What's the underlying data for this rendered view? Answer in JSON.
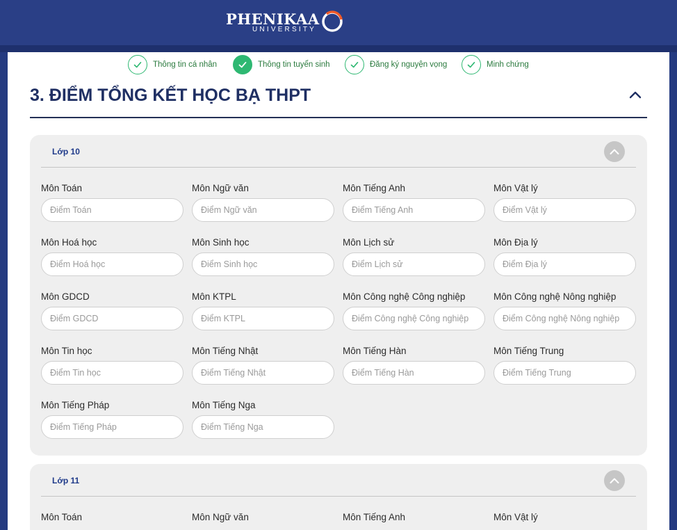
{
  "header": {
    "logo_main": "PHENIKAA",
    "logo_sub": "UNIVERSITY"
  },
  "steps": [
    {
      "label": "Thông tin cá nhân",
      "state": "done"
    },
    {
      "label": "Thông tin tuyển sinh",
      "state": "active"
    },
    {
      "label": "Đăng ký nguyện vọng",
      "state": "done"
    },
    {
      "label": "Minh chứng",
      "state": "done"
    }
  ],
  "section": {
    "title": "3. ĐIỂM TỔNG KẾT HỌC BẠ THPT",
    "collapse_icon": "chevron-up-icon"
  },
  "grade10": {
    "title": "Lớp 10",
    "fields": [
      {
        "label": "Môn Toán",
        "placeholder": "Điểm Toán"
      },
      {
        "label": "Môn Ngữ văn",
        "placeholder": "Điểm Ngữ văn"
      },
      {
        "label": "Môn Tiếng Anh",
        "placeholder": "Điểm Tiếng Anh"
      },
      {
        "label": "Môn Vật lý",
        "placeholder": "Điểm Vật lý"
      },
      {
        "label": "Môn Hoá học",
        "placeholder": "Điểm Hoá học"
      },
      {
        "label": "Môn Sinh học",
        "placeholder": "Điểm Sinh học"
      },
      {
        "label": "Môn Lịch sử",
        "placeholder": "Điểm Lịch sử"
      },
      {
        "label": "Môn Địa lý",
        "placeholder": "Điểm Địa lý"
      },
      {
        "label": "Môn GDCD",
        "placeholder": "Điểm GDCD"
      },
      {
        "label": "Môn KTPL",
        "placeholder": "Điểm KTPL"
      },
      {
        "label": "Môn Công nghệ Công nghiệp",
        "placeholder": "Điểm Công nghệ Công nghiệp"
      },
      {
        "label": "Môn Công nghệ Nông nghiệp",
        "placeholder": "Điểm Công nghệ Nông nghiệp"
      },
      {
        "label": "Môn Tin học",
        "placeholder": "Điểm Tin học"
      },
      {
        "label": "Môn Tiếng Nhật",
        "placeholder": "Điểm Tiếng Nhật"
      },
      {
        "label": "Môn Tiếng Hàn",
        "placeholder": "Điểm Tiếng Hàn"
      },
      {
        "label": "Môn Tiếng Trung",
        "placeholder": "Điểm Tiếng Trung"
      },
      {
        "label": "Môn Tiếng Pháp",
        "placeholder": "Điểm Tiếng Pháp"
      },
      {
        "label": "Môn Tiếng Nga",
        "placeholder": "Điểm Tiếng Nga"
      }
    ]
  },
  "grade11": {
    "title": "Lớp 11",
    "fields": [
      {
        "label": "Môn Toán"
      },
      {
        "label": "Môn Ngữ văn"
      },
      {
        "label": "Môn Tiếng Anh"
      },
      {
        "label": "Môn Vật lý"
      }
    ]
  },
  "colors": {
    "header_bg": "#2a3f86",
    "step_green": "#2eb872",
    "title_navy": "#1f2f63",
    "panel_bg": "#efefef"
  }
}
